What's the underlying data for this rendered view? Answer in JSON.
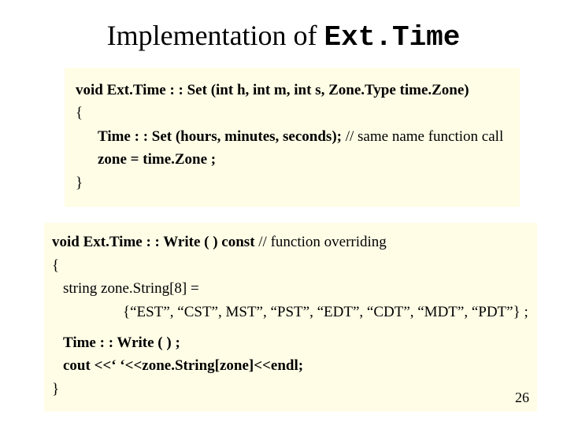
{
  "title": {
    "serif": "Implementation of ",
    "mono": "Ext.Time"
  },
  "box1": {
    "l1_bold": "void  Ext.Time : : Set (int h, int m, int s, Zone.Type time.Zone)",
    "l2": "{",
    "l3_bold": "Time : : Set (hours, minutes, seconds);",
    "l3_norm": "  // same name function call",
    "l4_bold": "zone  = time.Zone ;",
    "l5": "}"
  },
  "box2": {
    "l1_bold": "void  Ext.Time : : Write ( )   const",
    "l1_norm": "  // function overriding",
    "l2": "{",
    "l3": "string  zone.String[8] =",
    "l4": "{“EST”, “CST”, MST”, “PST”, “EDT”, “CDT”, “MDT”, “PDT”} ;",
    "l5_bold": "Time : : Write ( ) ;",
    "l6_bold": "cout  <<‘  ‘<<zone.String[zone]<<endl;",
    "l7": "}"
  },
  "pagenum": "26"
}
